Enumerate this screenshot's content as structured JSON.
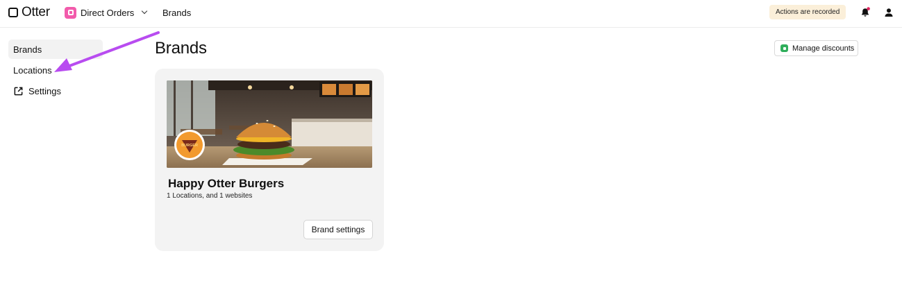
{
  "header": {
    "logo_text": "Otter",
    "app_name": "Direct Orders",
    "breadcrumb": "Brands",
    "actions_badge": "Actions are recorded",
    "notification_dot_color": "#e0245e"
  },
  "sidebar": {
    "items": [
      {
        "label": "Brands",
        "active": true
      },
      {
        "label": "Locations",
        "active": false
      },
      {
        "label": "Settings",
        "active": false,
        "icon": "external-link-icon"
      }
    ]
  },
  "main": {
    "title": "Brands",
    "manage_discounts_label": "Manage discounts",
    "brand_card": {
      "name": "Happy Otter Burgers",
      "meta": "1 Locations, and 1 websites",
      "settings_label": "Brand settings",
      "avatar_text": "BURGER"
    }
  },
  "annotation": {
    "arrow_color": "#b84cf0",
    "arrow_target": "Locations"
  }
}
